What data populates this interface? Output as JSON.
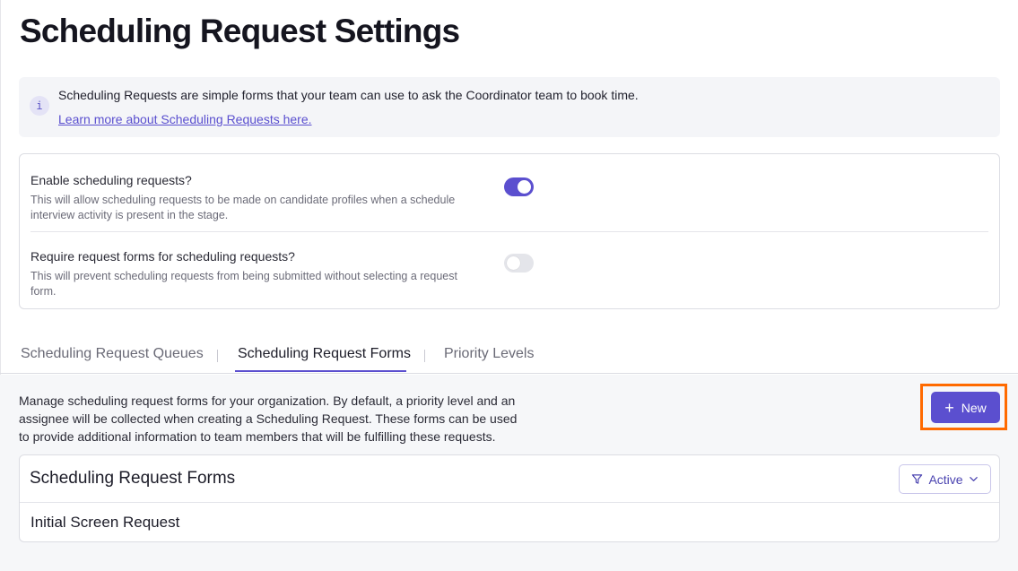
{
  "page": {
    "title": "Scheduling Request Settings"
  },
  "info_banner": {
    "icon": "info-icon",
    "icon_glyph": "i",
    "text": "Scheduling Requests are simple forms that your team can use to ask the Coordinator team to book time.",
    "link_text": "Learn more about Scheduling Requests here."
  },
  "settings": {
    "items": [
      {
        "title": "Enable scheduling requests?",
        "description": "This will allow scheduling requests to be made on candidate profiles when a schedule interview activity is present in the stage.",
        "enabled": true
      },
      {
        "title": "Require request forms for scheduling requests?",
        "description": "This will prevent scheduling requests from being submitted without selecting a request form.",
        "enabled": false
      }
    ]
  },
  "tabs": {
    "items": [
      {
        "label": "Scheduling Request Queues",
        "active": false
      },
      {
        "label": "Scheduling Request Forms",
        "active": true
      },
      {
        "label": "Priority Levels",
        "active": false
      }
    ]
  },
  "forms_section": {
    "description": "Manage scheduling request forms for your organization. By default, a priority level and an assignee will be collected when creating a Scheduling Request. These forms can be used to provide additional information to team members that will be fulfilling these requests.",
    "new_button": {
      "icon": "plus-icon",
      "icon_glyph": "+",
      "label": "New"
    },
    "card_title": "Scheduling Request Forms",
    "filter": {
      "icon": "filter-icon",
      "label": "Active",
      "chevron_icon": "chevron-down-icon"
    },
    "rows": [
      {
        "name": "Initial Screen Request"
      }
    ]
  },
  "colors": {
    "accent": "#5b4fcf",
    "highlight_border": "#ff6a00",
    "banner_bg": "#f4f5f8",
    "content_bg": "#f6f7f9"
  }
}
